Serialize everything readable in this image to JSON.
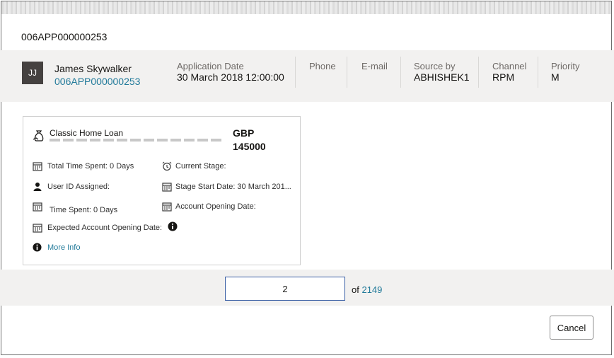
{
  "dialog": {
    "title": "006APP000000253"
  },
  "header": {
    "avatar_initials": "JJ",
    "customer_name": "James Skywalker",
    "application_number": "006APP000000253",
    "fields": [
      {
        "label": "Application Date",
        "value": "30 March 2018 12:00:00"
      },
      {
        "label": "Phone",
        "value": ""
      },
      {
        "label": "E-mail",
        "value": ""
      },
      {
        "label": "Source by",
        "value": "ABHISHEK1"
      },
      {
        "label": "Channel",
        "value": "RPM"
      },
      {
        "label": "Priority",
        "value": "M"
      }
    ]
  },
  "card": {
    "product": "Classic Home Loan",
    "currency": "GBP",
    "amount": "145000",
    "total_time_spent": "Total Time Spent: 0 Days",
    "current_stage": "Current Stage:",
    "user_id_assigned": "User ID Assigned:",
    "stage_start_date": "Stage Start Date: 30 March 201...",
    "time_spent": "Time Spent: 0 Days",
    "account_opening_date": "Account Opening Date:",
    "expected_account_opening_date": "Expected Account Opening Date:",
    "more_info": "More Info"
  },
  "pager": {
    "current_page": "2",
    "of_label": "of",
    "total_pages": "2149"
  },
  "footer": {
    "cancel_label": "Cancel"
  },
  "colors": {
    "link": "#227a9a",
    "band": "#f2f1f0",
    "avatar": "#454140",
    "input_border": "#3a5fa5"
  },
  "icons": [
    "product-bag-icon",
    "calendar-icon",
    "alarm-clock-icon",
    "user-icon",
    "info-icon"
  ]
}
